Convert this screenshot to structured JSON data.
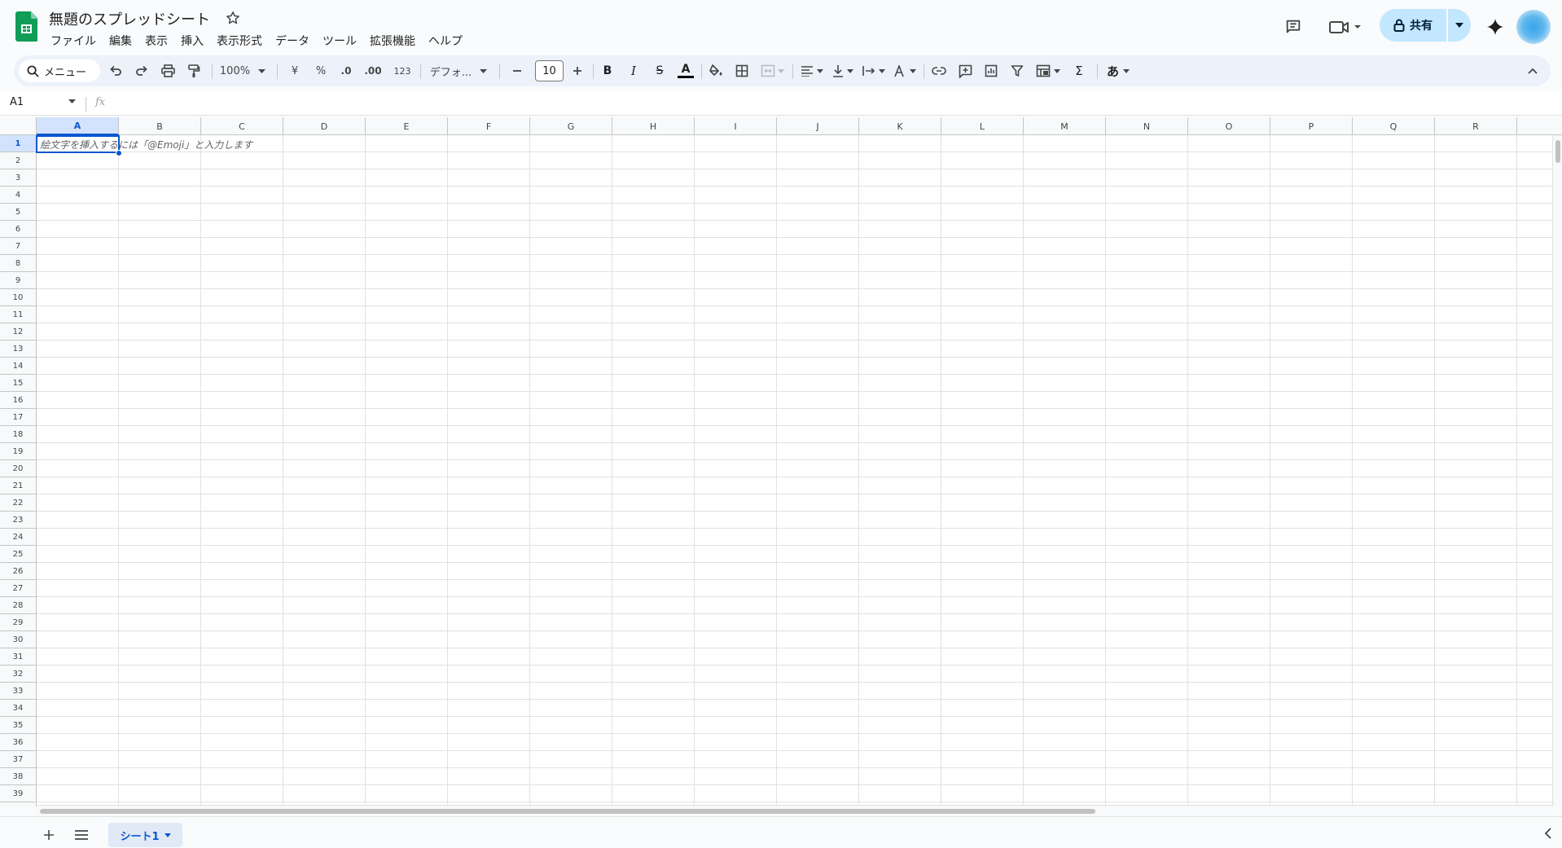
{
  "app": {
    "title": "無題のスプレッドシート"
  },
  "menu": [
    "ファイル",
    "編集",
    "表示",
    "挿入",
    "表示形式",
    "データ",
    "ツール",
    "拡張機能",
    "ヘルプ"
  ],
  "header": {
    "share_label": "共有"
  },
  "toolbar": {
    "search_label": "メニュー",
    "zoom": "100%",
    "currency": "¥",
    "percent": "%",
    "dec_less": ".0",
    "dec_more": ".00",
    "format_more": "123",
    "font": "デフォ...",
    "font_size": "10",
    "bold": "B",
    "italic": "I",
    "strike": "S",
    "text_color": "A",
    "sum": "Σ",
    "input_tools": "あ"
  },
  "formula_bar": {
    "name_box": "A1",
    "fx": "fx",
    "content": ""
  },
  "grid": {
    "columns": [
      "A",
      "B",
      "C",
      "D",
      "E",
      "F",
      "G",
      "H",
      "I",
      "J",
      "K",
      "L",
      "M",
      "N",
      "O",
      "P",
      "Q",
      "R"
    ],
    "rows": [
      "1",
      "2",
      "3",
      "4",
      "5",
      "6",
      "7",
      "8",
      "9",
      "10",
      "11",
      "12",
      "13",
      "14",
      "15",
      "16",
      "17",
      "18",
      "19",
      "20",
      "21",
      "22",
      "23",
      "24",
      "25",
      "26",
      "27",
      "28",
      "29",
      "30",
      "31",
      "32",
      "33",
      "34",
      "35",
      "36",
      "37",
      "38",
      "39"
    ],
    "selected_cell": "A1",
    "cell_hint": "絵文字を挿入するには「@Emoji」と入力します"
  },
  "sheets": {
    "tabs": [
      "シート1"
    ]
  },
  "colors": {
    "accent": "#0b57d0",
    "share_bg": "#c2e7ff",
    "logo_green": "#0f9d58"
  }
}
